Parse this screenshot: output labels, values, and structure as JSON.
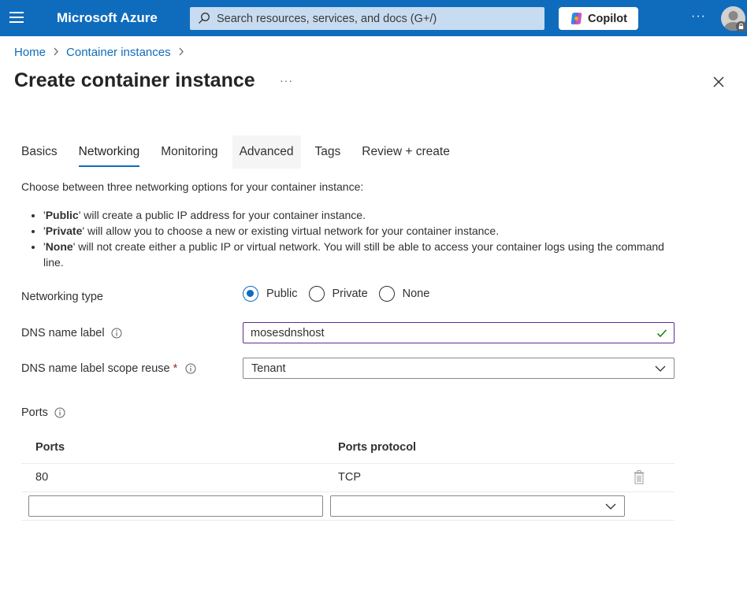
{
  "header": {
    "brand": "Microsoft Azure",
    "search_placeholder": "Search resources, services, and docs (G+/)",
    "copilot_label": "Copilot",
    "more_dots": "···"
  },
  "breadcrumb": {
    "items": [
      "Home",
      "Container instances"
    ],
    "separator": ">"
  },
  "page": {
    "title": "Create container instance",
    "more_dots": "···"
  },
  "tabs": [
    {
      "label": "Basics"
    },
    {
      "label": "Networking",
      "active": true
    },
    {
      "label": "Monitoring"
    },
    {
      "label": "Advanced"
    },
    {
      "label": "Tags"
    },
    {
      "label": "Review + create"
    }
  ],
  "intro": "Choose between three networking options for your container instance:",
  "bullets": [
    {
      "bold": "Public",
      "pre": "'",
      "post": "' will create a public IP address for your container instance."
    },
    {
      "bold": "Private",
      "pre": "'",
      "post": "' will allow you to choose a new or existing virtual network for your container instance."
    },
    {
      "bold": "None",
      "pre": "'",
      "post": "' will not create either a public IP or virtual network. You will still be able to access your container logs using the command line."
    }
  ],
  "form": {
    "networking_type": {
      "label": "Networking type",
      "options": [
        "Public",
        "Private",
        "None"
      ],
      "selected": "Public"
    },
    "dns_label": {
      "label": "DNS name label",
      "value": "mosesdnshost"
    },
    "dns_scope": {
      "label": "DNS name label scope reuse",
      "required_mark": "*",
      "value": "Tenant"
    },
    "ports_section_label": "Ports"
  },
  "ports_table": {
    "columns": [
      "Ports",
      "Ports protocol"
    ],
    "rows": [
      {
        "port": "80",
        "protocol": "TCP"
      }
    ],
    "new_row": {
      "port": "",
      "protocol": ""
    }
  },
  "colors": {
    "accent": "#0f6cbd",
    "topbar": "#0f6cbd",
    "valid_border": "#5c2e91",
    "valid_check": "#107c10",
    "required": "#a4262c"
  }
}
